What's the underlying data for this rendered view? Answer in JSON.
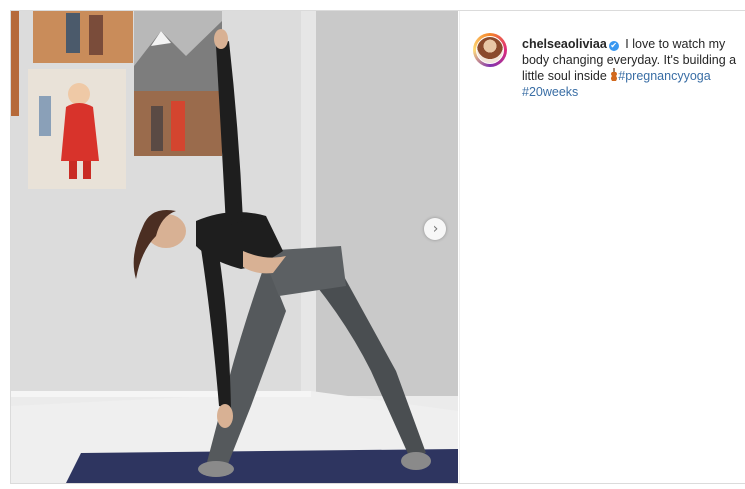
{
  "post": {
    "username": "chelseaoliviaa",
    "verified_badge": "✔",
    "caption_text": "I love to watch my body changing everyday. It's building a little soul inside",
    "hashtags": [
      "#pregnancyyoga",
      "#20weeks"
    ],
    "emoji_icon": "violin-emoji-icon",
    "next_icon": "›"
  },
  "colors": {
    "hashtag": "#3a6ea5",
    "verified": "#3897f0",
    "mat": "#2e3560"
  }
}
